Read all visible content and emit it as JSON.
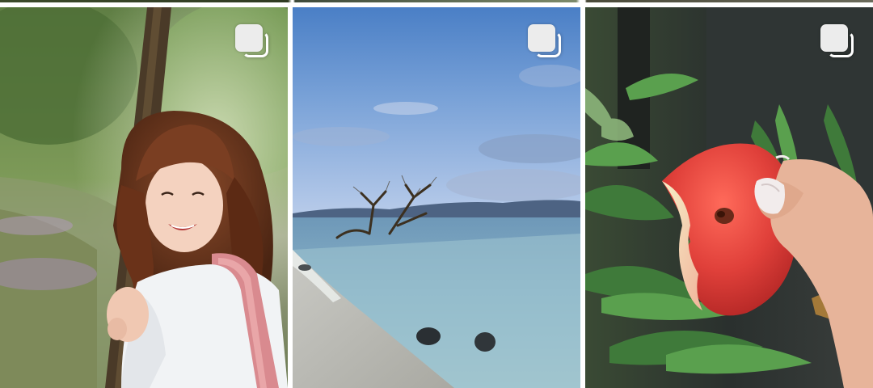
{
  "grid": {
    "posts": [
      {
        "subject": "portrait",
        "multi_photo": true,
        "icon": "carousel-icon"
      },
      {
        "subject": "beach",
        "multi_photo": true,
        "icon": "carousel-icon"
      },
      {
        "subject": "fruit",
        "multi_photo": true,
        "icon": "carousel-icon"
      }
    ]
  },
  "colors": {
    "background": "#ffffff",
    "icon_fill": "#ececec",
    "icon_outline": "#ffffff"
  }
}
